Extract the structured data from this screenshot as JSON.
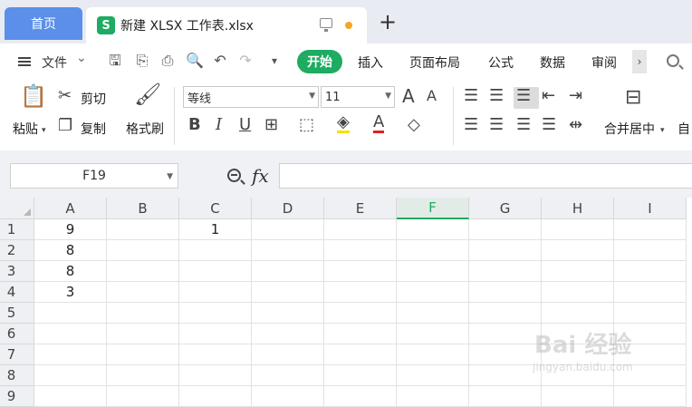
{
  "tabs": {
    "home_label": "首页",
    "doc_icon_letter": "S",
    "doc_title": "新建 XLSX 工作表.xlsx",
    "new_tab_symbol": "+"
  },
  "menu": {
    "file_label": "文件",
    "items": [
      "开始",
      "插入",
      "页面布局",
      "公式",
      "数据",
      "审阅"
    ],
    "more_symbol": "›"
  },
  "ribbon": {
    "paste_label": "粘贴",
    "cut_label": "剪切",
    "copy_label": "复制",
    "format_painter_label": "格式刷",
    "font_name": "等线",
    "font_size": "11",
    "bold_label": "B",
    "italic_label": "I",
    "underline_label": "U",
    "merge_center_label": "合并居中",
    "auto_wrap_label": "自",
    "font_color_letter": "A",
    "increase_font_label": "A",
    "decrease_font_label": "A"
  },
  "formula_bar": {
    "name_box": "F19",
    "fx_label": "fx",
    "formula_value": ""
  },
  "sheet": {
    "columns": [
      "A",
      "B",
      "C",
      "D",
      "E",
      "F",
      "G",
      "H",
      "I"
    ],
    "selected_column": "F",
    "rows": [
      "1",
      "2",
      "3",
      "4",
      "5",
      "6",
      "7",
      "8",
      "9"
    ],
    "cells": {
      "A1": "9",
      "A2": "8",
      "A3": "8",
      "A4": "3",
      "C1": "1"
    }
  },
  "watermark": {
    "text": "Bai 经验",
    "url_text": "jingyan.baidu.com"
  },
  "colors": {
    "accent_green": "#1eab62",
    "home_tab_blue": "#5b8fe9",
    "unsaved_dot": "#f5a623"
  }
}
